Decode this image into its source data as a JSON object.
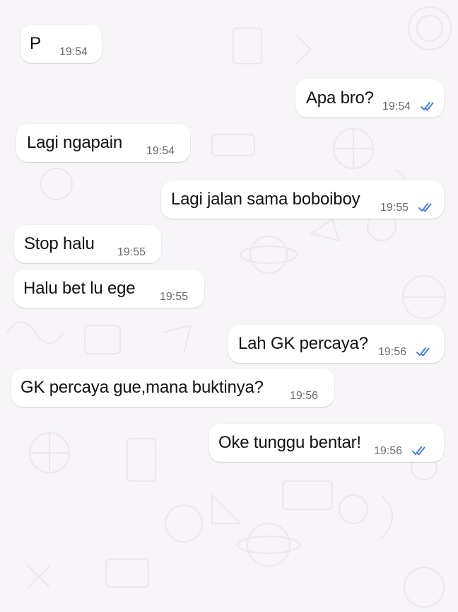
{
  "colors": {
    "bubble_in": "#ffffff",
    "bubble_out": "#ffffff",
    "read_ticks": "#4a7fe0",
    "timestamp": "#6b6b6b",
    "background": "#f7f5f8"
  },
  "messages": [
    {
      "direction": "incoming",
      "text": "P",
      "time": "19:54"
    },
    {
      "direction": "outgoing",
      "text": "Apa bro?",
      "time": "19:54",
      "status": "read"
    },
    {
      "direction": "incoming",
      "text": "Lagi ngapain",
      "time": "19:54"
    },
    {
      "direction": "outgoing",
      "text": "Lagi jalan sama boboiboy",
      "time": "19:55",
      "status": "read"
    },
    {
      "direction": "incoming",
      "text": "Stop halu",
      "time": "19:55"
    },
    {
      "direction": "incoming",
      "text": "Halu bet lu ege",
      "time": "19:55"
    },
    {
      "direction": "outgoing",
      "text": "Lah GK percaya?",
      "time": "19:56",
      "status": "read"
    },
    {
      "direction": "incoming",
      "text": "GK percaya gue,mana buktinya?",
      "time": "19:56"
    },
    {
      "direction": "outgoing",
      "text": "Oke tunggu bentar!",
      "time": "19:56",
      "status": "read"
    }
  ]
}
